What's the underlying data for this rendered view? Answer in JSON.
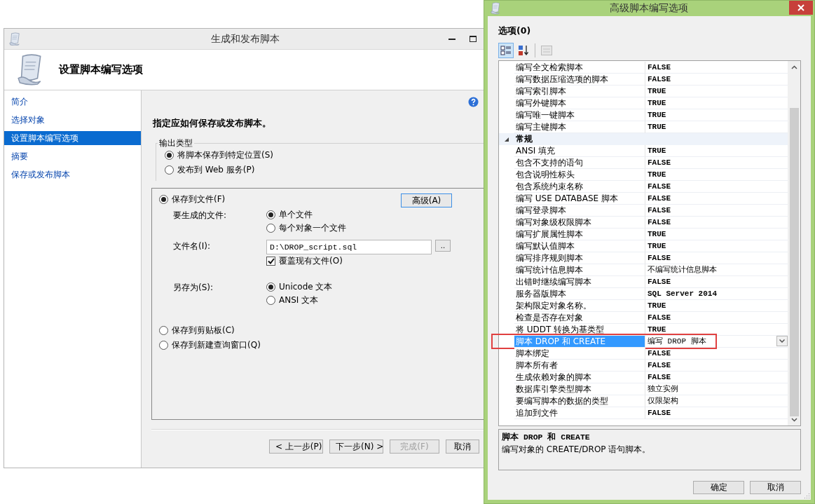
{
  "main_window": {
    "title": "生成和发布脚本",
    "header_title": "设置脚本编写选项",
    "sidebar": [
      {
        "label": "简介",
        "selected": false
      },
      {
        "label": "选择对象",
        "selected": false
      },
      {
        "label": "设置脚本编写选项",
        "selected": true
      },
      {
        "label": "摘要",
        "selected": false
      },
      {
        "label": "保存或发布脚本",
        "selected": false
      }
    ],
    "heading": "指定应如何保存或发布脚本。",
    "output_type": {
      "legend": "输出类型",
      "options": [
        {
          "label": "将脚本保存到特定位置(S)",
          "selected": true
        },
        {
          "label": "发布到 Web 服务(P)",
          "selected": false
        }
      ]
    },
    "save_to_file": {
      "label": "保存到文件(F)",
      "selected": true,
      "advanced_button": "高级(A)",
      "files_label": "要生成的文件:",
      "file_options": [
        {
          "label": "单个文件",
          "selected": true
        },
        {
          "label": "每个对象一个文件",
          "selected": false
        }
      ],
      "filename_label": "文件名(I):",
      "filename": "D:\\DROP_script.sql",
      "browse_button": "..",
      "overwrite": {
        "label": "覆盖现有文件(O)",
        "checked": true
      },
      "save_as_label": "另存为(S):",
      "encoding_options": [
        {
          "label": "Unicode 文本",
          "selected": true
        },
        {
          "label": "ANSI 文本",
          "selected": false
        }
      ]
    },
    "other_destinations": [
      {
        "label": "保存到剪贴板(C)",
        "selected": false
      },
      {
        "label": "保存到新建查询窗口(Q)",
        "selected": false
      }
    ],
    "footer_buttons": [
      {
        "label": "< 上一步(P)",
        "disabled": false
      },
      {
        "label": "下一步(N) >",
        "disabled": false
      },
      {
        "label": "完成(F)",
        "disabled": true
      },
      {
        "label": "取消",
        "disabled": false
      }
    ]
  },
  "dialog": {
    "title": "高级脚本编写选项",
    "options_label": "选项(0)",
    "toolbar": [
      {
        "kind": "categorized",
        "selected": true,
        "disabled": false
      },
      {
        "kind": "alphabetical",
        "selected": false,
        "disabled": false
      },
      {
        "kind": "property-pages",
        "selected": false,
        "disabled": true
      }
    ],
    "rows": [
      {
        "kind": "property",
        "name": "编写全文检索脚本",
        "value": "FALSE",
        "selected": false,
        "marked": false
      },
      {
        "kind": "property",
        "name": "编写数据压缩选项的脚本",
        "value": "FALSE",
        "selected": false,
        "marked": false
      },
      {
        "kind": "property",
        "name": "编写索引脚本",
        "value": "TRUE",
        "selected": false,
        "marked": false
      },
      {
        "kind": "property",
        "name": "编写外键脚本",
        "value": "TRUE",
        "selected": false,
        "marked": false
      },
      {
        "kind": "property",
        "name": "编写唯一键脚本",
        "value": "TRUE",
        "selected": false,
        "marked": false
      },
      {
        "kind": "property",
        "name": "编写主键脚本",
        "value": "TRUE",
        "selected": false,
        "marked": false
      },
      {
        "kind": "category",
        "name": "常规",
        "expanded": true
      },
      {
        "kind": "property",
        "name": "ANSI 填充",
        "value": "TRUE",
        "selected": false,
        "marked": false
      },
      {
        "kind": "property",
        "name": "包含不支持的语句",
        "value": "FALSE",
        "selected": false,
        "marked": false
      },
      {
        "kind": "property",
        "name": "包含说明性标头",
        "value": "TRUE",
        "selected": false,
        "marked": false
      },
      {
        "kind": "property",
        "name": "包含系统约束名称",
        "value": "FALSE",
        "selected": false,
        "marked": false
      },
      {
        "kind": "property",
        "name": "编写 USE DATABASE 脚本",
        "value": "FALSE",
        "selected": false,
        "marked": false
      },
      {
        "kind": "property",
        "name": "编写登录脚本",
        "value": "FALSE",
        "selected": false,
        "marked": false
      },
      {
        "kind": "property",
        "name": "编写对象级权限脚本",
        "value": "FALSE",
        "selected": false,
        "marked": false
      },
      {
        "kind": "property",
        "name": "编写扩展属性脚本",
        "value": "TRUE",
        "selected": false,
        "marked": false
      },
      {
        "kind": "property",
        "name": "编写默认值脚本",
        "value": "TRUE",
        "selected": false,
        "marked": false
      },
      {
        "kind": "property",
        "name": "编写排序规则脚本",
        "value": "FALSE",
        "selected": false,
        "marked": false
      },
      {
        "kind": "property",
        "name": "编写统计信息脚本",
        "value": "不编写统计信息脚本",
        "selected": false,
        "marked": false
      },
      {
        "kind": "property",
        "name": "出错时继续编写脚本",
        "value": "FALSE",
        "selected": false,
        "marked": false
      },
      {
        "kind": "property",
        "name": "服务器版脚本",
        "value": "SQL Server 2014",
        "selected": false,
        "marked": false
      },
      {
        "kind": "property",
        "name": "架构限定对象名称。",
        "value": "TRUE",
        "selected": false,
        "marked": false
      },
      {
        "kind": "property",
        "name": "检查是否存在对象",
        "value": "FALSE",
        "selected": false,
        "marked": false
      },
      {
        "kind": "property",
        "name": "将 UDDT 转换为基类型",
        "value": "TRUE",
        "selected": false,
        "marked": false
      },
      {
        "kind": "property",
        "name": "脚本 DROP 和 CREATE",
        "value": "编写 DROP 脚本",
        "selected": true,
        "marked": true
      },
      {
        "kind": "property",
        "name": "脚本绑定",
        "value": "FALSE",
        "selected": false,
        "marked": false
      },
      {
        "kind": "property",
        "name": "脚本所有者",
        "value": "FALSE",
        "selected": false,
        "marked": false
      },
      {
        "kind": "property",
        "name": "生成依赖对象的脚本",
        "value": "FALSE",
        "selected": false,
        "marked": false
      },
      {
        "kind": "property",
        "name": "数据库引擎类型脚本",
        "value": "独立实例",
        "selected": false,
        "marked": false
      },
      {
        "kind": "property",
        "name": "要编写脚本的数据的类型",
        "value": "仅限架构",
        "selected": false,
        "marked": false
      },
      {
        "kind": "property",
        "name": "追加到文件",
        "value": "FALSE",
        "selected": false,
        "marked": false
      }
    ],
    "description": {
      "title": "脚本 DROP 和 CREATE",
      "text": "编写对象的 CREATE/DROP 语句脚本。"
    },
    "buttons": [
      "确定",
      "取消"
    ]
  }
}
